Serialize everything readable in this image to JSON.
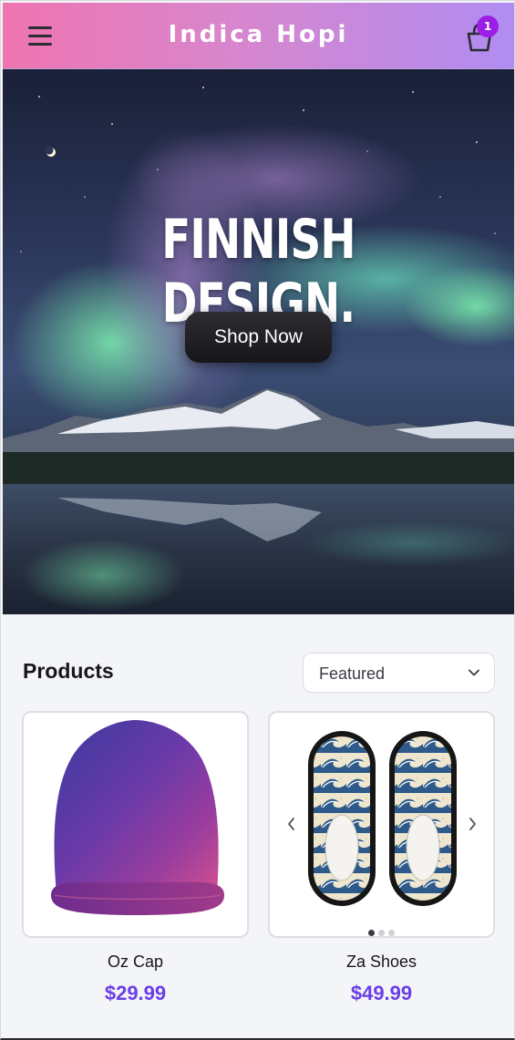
{
  "header": {
    "brand": "Indica Hopi",
    "cart_count": "1",
    "menu_icon": "hamburger-icon",
    "cart_icon": "shopping-bag-icon",
    "gradient_start": "#ef74b0",
    "gradient_end": "#b08cf2",
    "badge_color": "#9b1ee6"
  },
  "hero": {
    "title": "FINNISH DESIGN.",
    "cta_label": "Shop Now"
  },
  "products": {
    "heading": "Products",
    "sort_selected": "Featured",
    "price_color": "#6a3ee6",
    "items": [
      {
        "name": "Oz Cap",
        "price": "$29.99"
      },
      {
        "name": "Za Shoes",
        "price": "$49.99",
        "carousel_index": 1,
        "carousel_total": 3
      }
    ]
  }
}
